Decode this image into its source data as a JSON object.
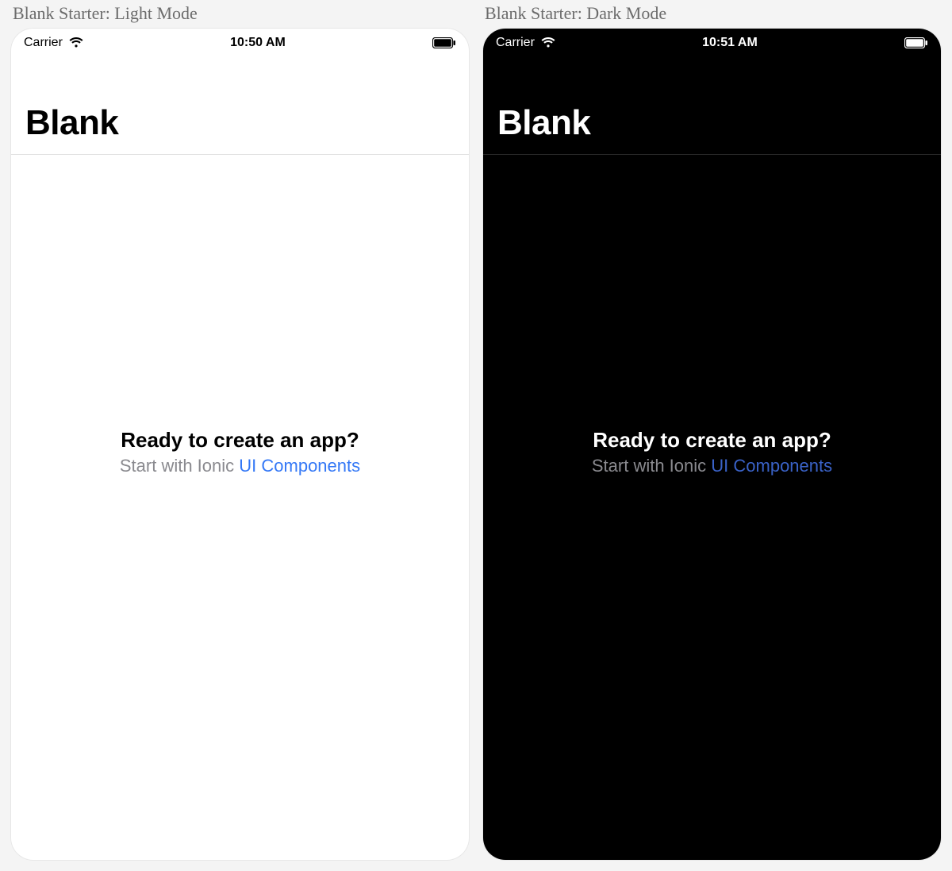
{
  "light": {
    "caption": "Blank Starter: Light Mode",
    "status": {
      "carrier": "Carrier",
      "time": "10:50 AM"
    },
    "header": {
      "title": "Blank"
    },
    "main": {
      "heading": "Ready to create an app?",
      "subtext_prefix": "Start with Ionic ",
      "link_label": "UI Components"
    }
  },
  "dark": {
    "caption": "Blank Starter: Dark Mode",
    "status": {
      "carrier": "Carrier",
      "time": "10:51 AM"
    },
    "header": {
      "title": "Blank"
    },
    "main": {
      "heading": "Ready to create an app?",
      "subtext_prefix": "Start with Ionic ",
      "link_label": "UI Components"
    }
  },
  "colors": {
    "light_bg": "#ffffff",
    "dark_bg": "#000000",
    "link_light": "#3478f6",
    "link_dark": "#3a62c7"
  }
}
